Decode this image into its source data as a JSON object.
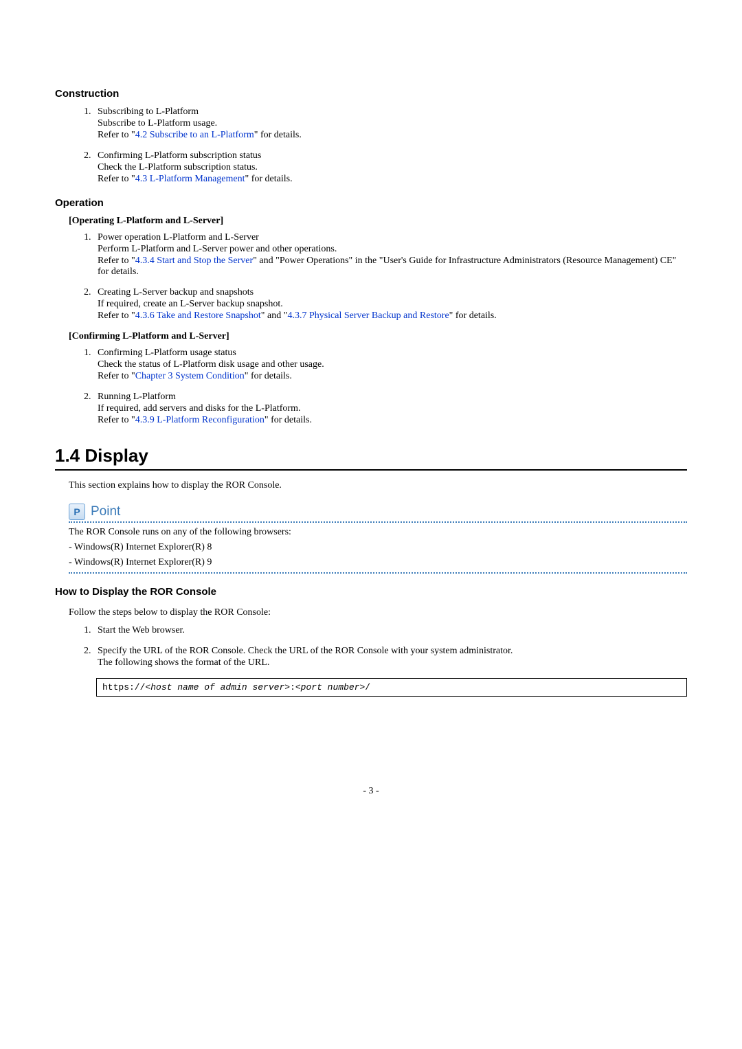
{
  "construction": {
    "heading": "Construction",
    "items": [
      {
        "title": "Subscribing to L-Platform",
        "line1": "Subscribe to L-Platform usage.",
        "refer_pre": "Refer to \"",
        "link": "4.2 Subscribe to an L-Platform",
        "refer_post": "\" for details."
      },
      {
        "title": "Confirming L-Platform subscription status",
        "line1": "Check the L-Platform subscription status.",
        "refer_pre": "Refer to \"",
        "link": "4.3 L-Platform Management",
        "refer_post": "\" for details."
      }
    ]
  },
  "operation": {
    "heading": "Operation",
    "group1_heading": "[Operating L-Platform and L-Server]",
    "group1": [
      {
        "title": "Power operation L-Platform and L-Server",
        "line1": "Perform L-Platform and L-Server power and other operations.",
        "refer_pre": "Refer to \"",
        "link": "4.3.4 Start and Stop the Server",
        "refer_post": "\" and \"Power Operations\" in the \"User's Guide for Infrastructure Administrators (Resource Management) CE\" for details."
      },
      {
        "title": "Creating L-Server backup and snapshots",
        "line1": "If required, create an L-Server backup snapshot.",
        "refer_pre": "Refer to \"",
        "link": "4.3.6 Take and Restore Snapshot",
        "mid": "\" and \"",
        "link2": "4.3.7 Physical Server Backup and Restore",
        "refer_post": "\" for details."
      }
    ],
    "group2_heading": "[Confirming L-Platform and L-Server]",
    "group2": [
      {
        "title": "Confirming L-Platform usage status",
        "line1": "Check the status of L-Platform disk usage and other usage.",
        "refer_pre": "Refer to \"",
        "link": "Chapter 3 System Condition",
        "refer_post": "\" for details."
      },
      {
        "title": "Running L-Platform",
        "line1": "If required, add servers and disks for the L-Platform.",
        "refer_pre": "Refer to \"",
        "link": "4.3.9 L-Platform Reconfiguration",
        "refer_post": "\" for details."
      }
    ]
  },
  "display": {
    "heading": "1.4 Display",
    "intro": "This section explains how to display the ROR Console.",
    "point_icon": "P",
    "point_label": "Point",
    "point_text": "The ROR Console runs on any of the following browsers:",
    "browsers": [
      "Windows(R) Internet Explorer(R) 8",
      "Windows(R) Internet Explorer(R) 9"
    ],
    "howto_heading": "How to Display the ROR Console",
    "howto_intro": "Follow the steps below to display the ROR Console:",
    "steps": [
      {
        "title": "Start the Web browser."
      },
      {
        "title": "Specify the URL of the ROR Console. Check the URL of the ROR Console with your system administrator.",
        "line1": "The following shows the format of the URL."
      }
    ],
    "code_prefix": "https://<",
    "code_host": "host name of admin server",
    "code_mid": ">:<",
    "code_port": "port number",
    "code_suffix": ">/"
  },
  "page_number": "- 3 -"
}
